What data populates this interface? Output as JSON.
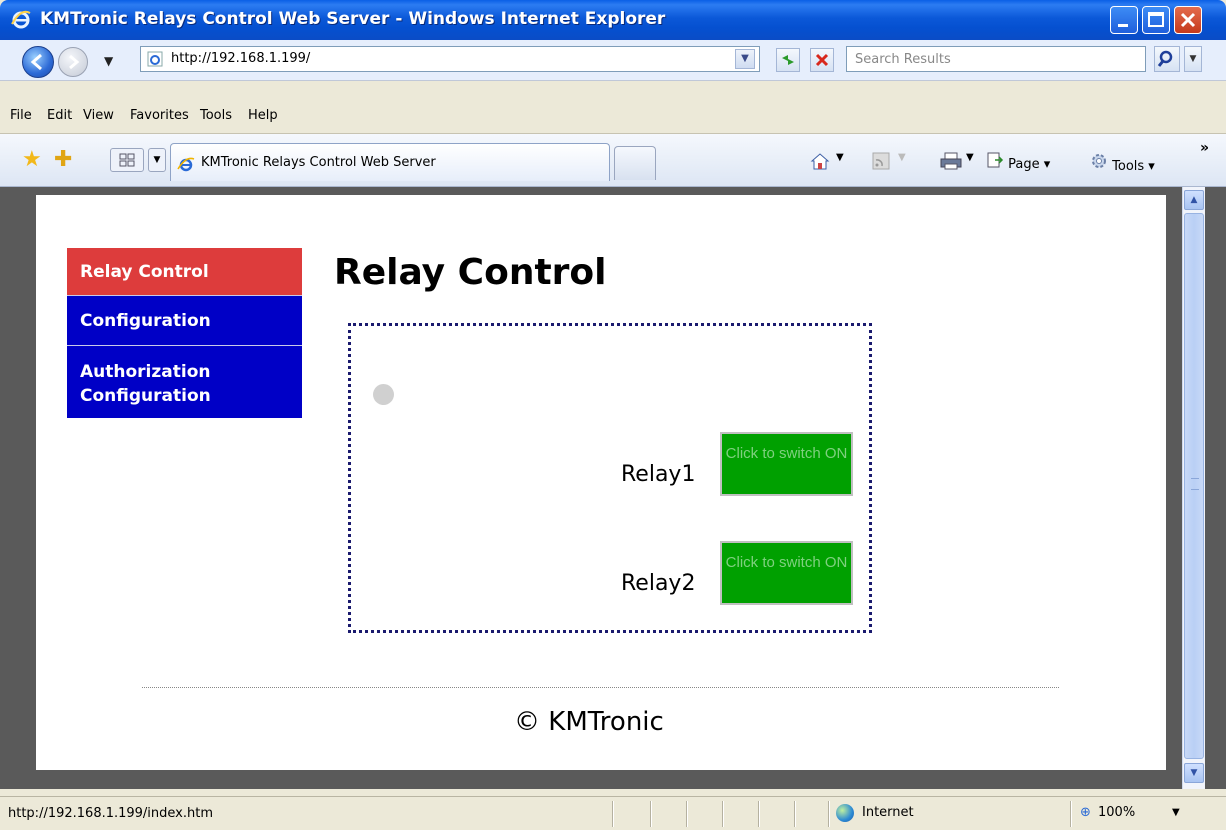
{
  "window": {
    "title": "KMTronic Relays Control Web Server - Windows Internet Explorer"
  },
  "address_bar": {
    "url": "http://192.168.1.199/",
    "search_placeholder": "Search Results"
  },
  "menu": [
    "File",
    "Edit",
    "View",
    "Favorites",
    "Tools",
    "Help"
  ],
  "tab": {
    "label": "KMTronic Relays Control Web Server"
  },
  "command_bar": {
    "page_label": "Page",
    "tools_label": "Tools"
  },
  "webpage": {
    "nav": [
      {
        "label": "Relay Control",
        "active": true
      },
      {
        "label": "Configuration",
        "active": false
      },
      {
        "label": "Authorization Configuration",
        "active": false
      }
    ],
    "title": "Relay Control",
    "relays": [
      {
        "label": "Relay1",
        "button": "Click to switch ON"
      },
      {
        "label": "Relay2",
        "button": "Click to switch ON"
      }
    ],
    "footer": "© KMTronic"
  },
  "status_bar": {
    "text": "http://192.168.1.199/index.htm",
    "zone": "Internet",
    "zoom": "100%"
  },
  "colors": {
    "nav_active": "#dd3c3c",
    "nav_inactive": "#0000c6",
    "relay_button": "#00a000",
    "titlebar": "#0550d0"
  }
}
